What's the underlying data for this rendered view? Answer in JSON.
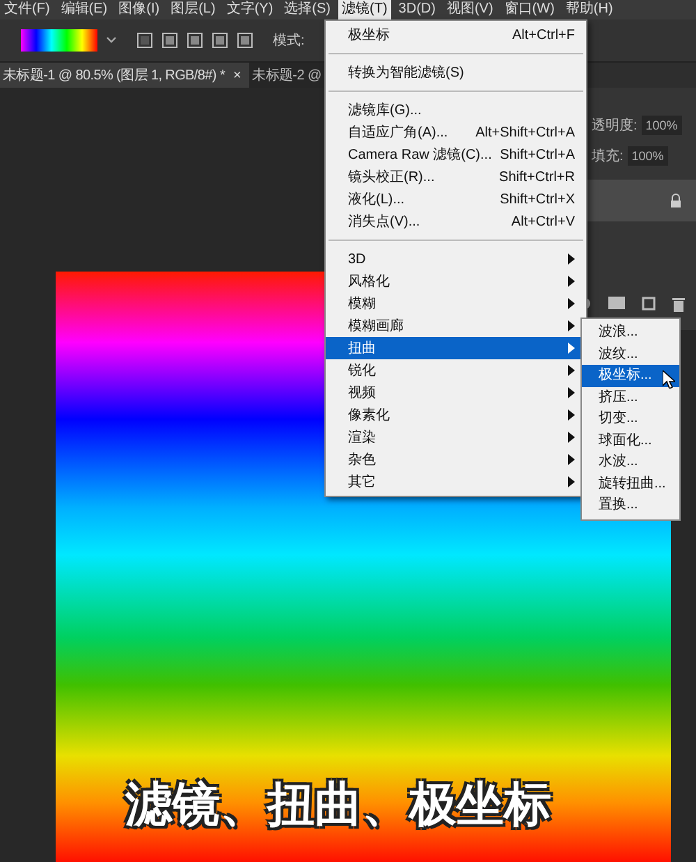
{
  "menubar": [
    {
      "label": "文件(F)",
      "selected": false
    },
    {
      "label": "编辑(E)",
      "selected": false
    },
    {
      "label": "图像(I)",
      "selected": false
    },
    {
      "label": "图层(L)",
      "selected": false
    },
    {
      "label": "文字(Y)",
      "selected": false
    },
    {
      "label": "选择(S)",
      "selected": false
    },
    {
      "label": "滤镜(T)",
      "selected": true
    },
    {
      "label": "3D(D)",
      "selected": false
    },
    {
      "label": "视图(V)",
      "selected": false
    },
    {
      "label": "窗口(W)",
      "selected": false
    },
    {
      "label": "帮助(H)",
      "selected": false
    }
  ],
  "options_bar": {
    "mode_label": "模式:"
  },
  "tabs": [
    {
      "label": "未标题-1 @ 80.5% (图层 1, RGB/8#) *",
      "close": "×",
      "selected": true
    },
    {
      "label": "未标题-2 @",
      "selected": false
    }
  ],
  "layers_panel": {
    "opacity_label": "透明度:",
    "opacity_value": "100%",
    "fill_label": "填充:",
    "fill_value": "100%"
  },
  "filter_menu": [
    {
      "kind": "item",
      "label": "极坐标",
      "shortcut": "Alt+Ctrl+F",
      "selected": false
    },
    {
      "kind": "separator"
    },
    {
      "kind": "item",
      "label": "转换为智能滤镜(S)",
      "selected": false
    },
    {
      "kind": "separator"
    },
    {
      "kind": "item",
      "label": "滤镜库(G)...",
      "selected": false
    },
    {
      "kind": "item",
      "label": "自适应广角(A)...",
      "shortcut": "Alt+Shift+Ctrl+A",
      "selected": false
    },
    {
      "kind": "item",
      "label": "Camera Raw 滤镜(C)...",
      "shortcut": "Shift+Ctrl+A",
      "selected": false
    },
    {
      "kind": "item",
      "label": "镜头校正(R)...",
      "shortcut": "Shift+Ctrl+R",
      "selected": false
    },
    {
      "kind": "item",
      "label": "液化(L)...",
      "shortcut": "Shift+Ctrl+X",
      "selected": false
    },
    {
      "kind": "item",
      "label": "消失点(V)...",
      "shortcut": "Alt+Ctrl+V",
      "selected": false
    },
    {
      "kind": "separator"
    },
    {
      "kind": "submenu",
      "label": "3D",
      "selected": false
    },
    {
      "kind": "submenu",
      "label": "风格化",
      "selected": false
    },
    {
      "kind": "submenu",
      "label": "模糊",
      "selected": false
    },
    {
      "kind": "submenu",
      "label": "模糊画廊",
      "selected": false
    },
    {
      "kind": "submenu",
      "label": "扭曲",
      "selected": true
    },
    {
      "kind": "submenu",
      "label": "锐化",
      "selected": false
    },
    {
      "kind": "submenu",
      "label": "视频",
      "selected": false
    },
    {
      "kind": "submenu",
      "label": "像素化",
      "selected": false
    },
    {
      "kind": "submenu",
      "label": "渲染",
      "selected": false
    },
    {
      "kind": "submenu",
      "label": "杂色",
      "selected": false
    },
    {
      "kind": "submenu",
      "label": "其它",
      "selected": false
    }
  ],
  "distort_submenu": [
    {
      "label": "波浪...",
      "selected": false
    },
    {
      "label": "波纹...",
      "selected": false
    },
    {
      "label": "极坐标...",
      "selected": true
    },
    {
      "label": "挤压...",
      "selected": false
    },
    {
      "label": "切变...",
      "selected": false
    },
    {
      "label": "球面化...",
      "selected": false
    },
    {
      "label": "水波...",
      "selected": false
    },
    {
      "label": "旋转扭曲...",
      "selected": false
    },
    {
      "label": "置换...",
      "selected": false
    }
  ],
  "caption": "滤镜、扭曲、极坐标"
}
